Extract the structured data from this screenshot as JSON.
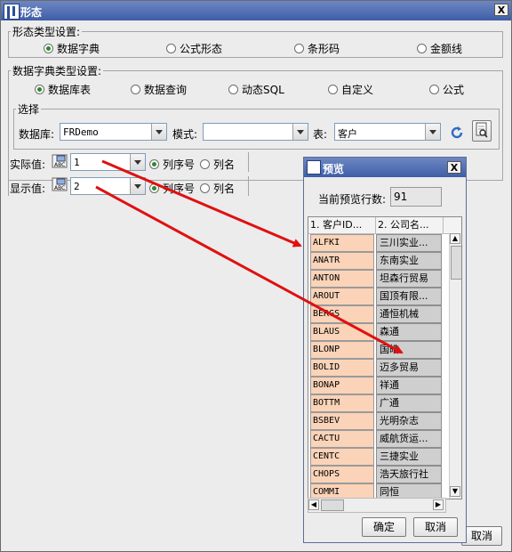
{
  "window": {
    "title": "形态",
    "close": "X"
  },
  "form_type": {
    "legend": "形态类型设置:",
    "options": [
      {
        "label": "数据字典",
        "selected": true
      },
      {
        "label": "公式形态",
        "selected": false
      },
      {
        "label": "条形码",
        "selected": false
      },
      {
        "label": "金额线",
        "selected": false
      }
    ]
  },
  "dict_type": {
    "legend": "数据字典类型设置:",
    "options": [
      {
        "label": "数据库表",
        "selected": true
      },
      {
        "label": "数据查询",
        "selected": false
      },
      {
        "label": "动态SQL",
        "selected": false
      },
      {
        "label": "自定义",
        "selected": false
      },
      {
        "label": "公式",
        "selected": false
      }
    ]
  },
  "select": {
    "legend": "选择",
    "database_label": "数据库:",
    "database_value": "FRDemo",
    "schema_label": "模式:",
    "schema_value": "",
    "table_label": "表:",
    "table_value": "客户"
  },
  "actual": {
    "label": "实际值:",
    "value": "1",
    "opt1": "列序号",
    "opt2": "列名",
    "selected": "opt1"
  },
  "display": {
    "label": "显示值:",
    "value": "2",
    "opt1": "列序号",
    "opt2": "列名",
    "selected": "opt1"
  },
  "main_buttons": {
    "cancel": "取消"
  },
  "preview": {
    "title": "预览",
    "close": "X",
    "count_label": "当前预览行数:",
    "count_value": "91",
    "col1": "1. 客户ID...",
    "col2": "2. 公司名...",
    "rows": [
      {
        "id": "ALFKI",
        "name": "三川实业..."
      },
      {
        "id": "ANATR",
        "name": "东南实业"
      },
      {
        "id": "ANTON",
        "name": "坦森行贸易"
      },
      {
        "id": "AROUT",
        "name": "国顶有限..."
      },
      {
        "id": "BERGS",
        "name": "通恒机械"
      },
      {
        "id": "BLAUS",
        "name": "森通"
      },
      {
        "id": "BLONP",
        "name": "国皓"
      },
      {
        "id": "BOLID",
        "name": "迈多贸易"
      },
      {
        "id": "BONAP",
        "name": "祥通"
      },
      {
        "id": "BOTTM",
        "name": "广通"
      },
      {
        "id": "BSBEV",
        "name": "光明杂志"
      },
      {
        "id": "CACTU",
        "name": "威航货运..."
      },
      {
        "id": "CENTC",
        "name": "三捷实业"
      },
      {
        "id": "CHOPS",
        "name": "浩天旅行社"
      },
      {
        "id": "COMMI",
        "name": "同恒"
      }
    ],
    "ok": "确定",
    "cancel": "取消"
  },
  "colors": {
    "title_bar": "#3e5ea6",
    "id_cell": "#fad3b8",
    "name_cell": "#cfcfcf",
    "arrow": "#e01010"
  }
}
